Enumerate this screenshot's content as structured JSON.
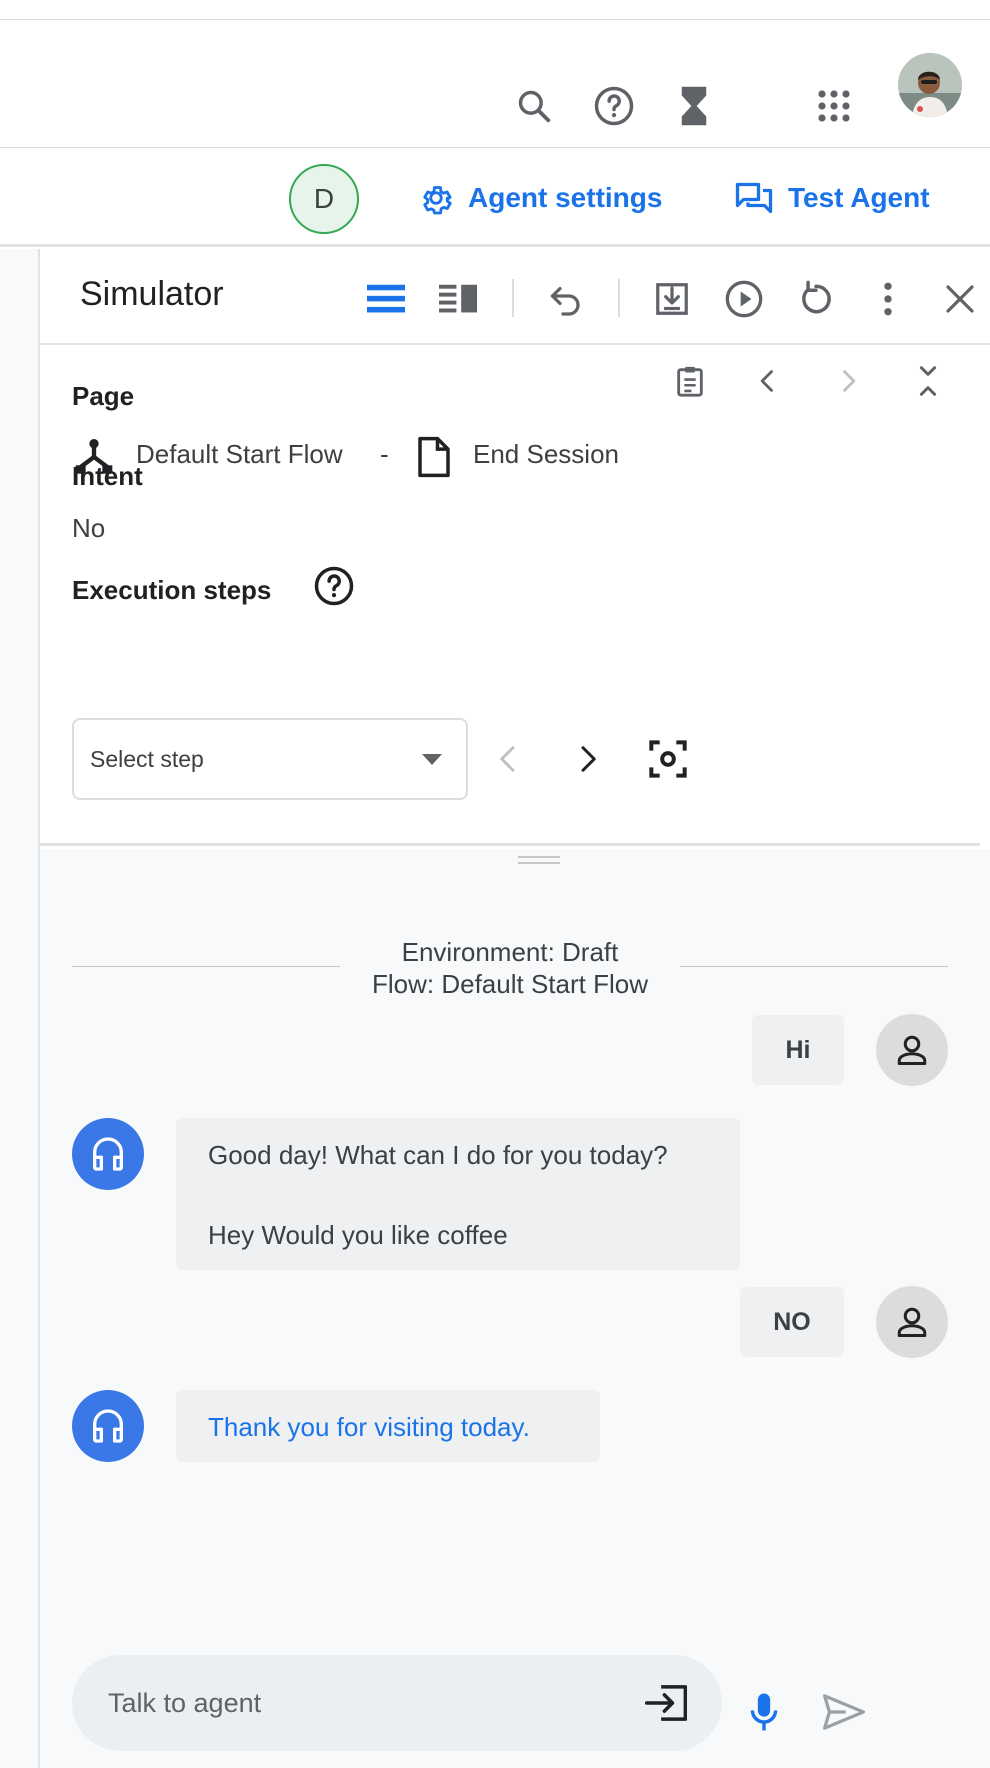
{
  "topbar": {
    "icons": [
      "search-icon",
      "help-icon",
      "hourglass-icon",
      "apps-grid-icon"
    ],
    "avatar": "account-avatar"
  },
  "agentbar": {
    "badge_letter": "D",
    "agent_settings_label": "Agent settings",
    "test_agent_label": "Test Agent"
  },
  "simulator": {
    "title": "Simulator",
    "header_icons": [
      "list-view-icon",
      "split-view-icon",
      "undo-icon",
      "export-icon",
      "play-icon",
      "reset-icon",
      "more-vert-icon",
      "close-icon"
    ],
    "page_label": "Page",
    "flow_name": "Default Start Flow",
    "separator": "-",
    "page_name": "End Session",
    "intent_label": "Intent",
    "intent_value": "No",
    "execution_label": "Execution steps",
    "select_placeholder": "Select step"
  },
  "chat": {
    "environment": "Environment: Draft",
    "flow": "Flow: Default Start Flow",
    "messages": [
      {
        "role": "user",
        "text": "Hi"
      },
      {
        "role": "agent",
        "lines": [
          "Good day! What can I do for you today?",
          "Hey Would you like coffee"
        ]
      },
      {
        "role": "user",
        "text": "NO"
      },
      {
        "role": "agent",
        "text": "Thank you for visiting today."
      }
    ],
    "input_placeholder": "Talk to agent"
  },
  "colors": {
    "accent": "#1a73e8",
    "agent_avatar": "#3b78e7",
    "badge_bg": "#e6f4ea",
    "badge_border": "#34a853"
  }
}
